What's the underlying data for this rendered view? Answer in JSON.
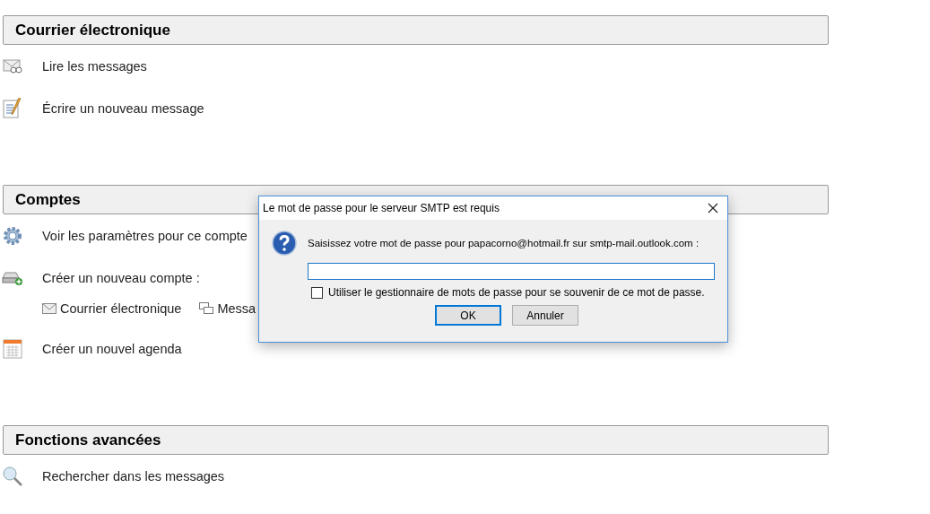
{
  "sections": [
    {
      "title": "Courrier électronique",
      "items": [
        {
          "kind": "action",
          "label": "Lire les messages"
        },
        {
          "kind": "action",
          "label": "Écrire un nouveau message"
        }
      ]
    },
    {
      "title": "Comptes",
      "items": [
        {
          "kind": "action",
          "label": "Voir les paramètres pour ce compte"
        },
        {
          "kind": "action",
          "label": "Créer un nouveau compte :"
        },
        {
          "kind": "links",
          "links": [
            "Courrier électronique",
            "Messa"
          ]
        },
        {
          "kind": "action",
          "label": "Créer un nouvel agenda"
        }
      ]
    },
    {
      "title": "Fonctions avancées",
      "items": [
        {
          "kind": "action",
          "label": "Rechercher dans les messages"
        }
      ]
    }
  ],
  "dialog": {
    "title": "Le mot de passe pour le serveur SMTP est requis",
    "message": "Saisissez votre mot de passe pour papacorno@hotmail.fr sur smtp-mail.outlook.com :",
    "checkbox": {
      "label": "Utiliser le gestionnaire de mots de passe pour se souvenir de ce mot de passe.",
      "checked": false
    },
    "buttons": [
      {
        "label": "OK",
        "selected": true
      },
      {
        "label": "Annuler",
        "selected": false
      }
    ]
  }
}
